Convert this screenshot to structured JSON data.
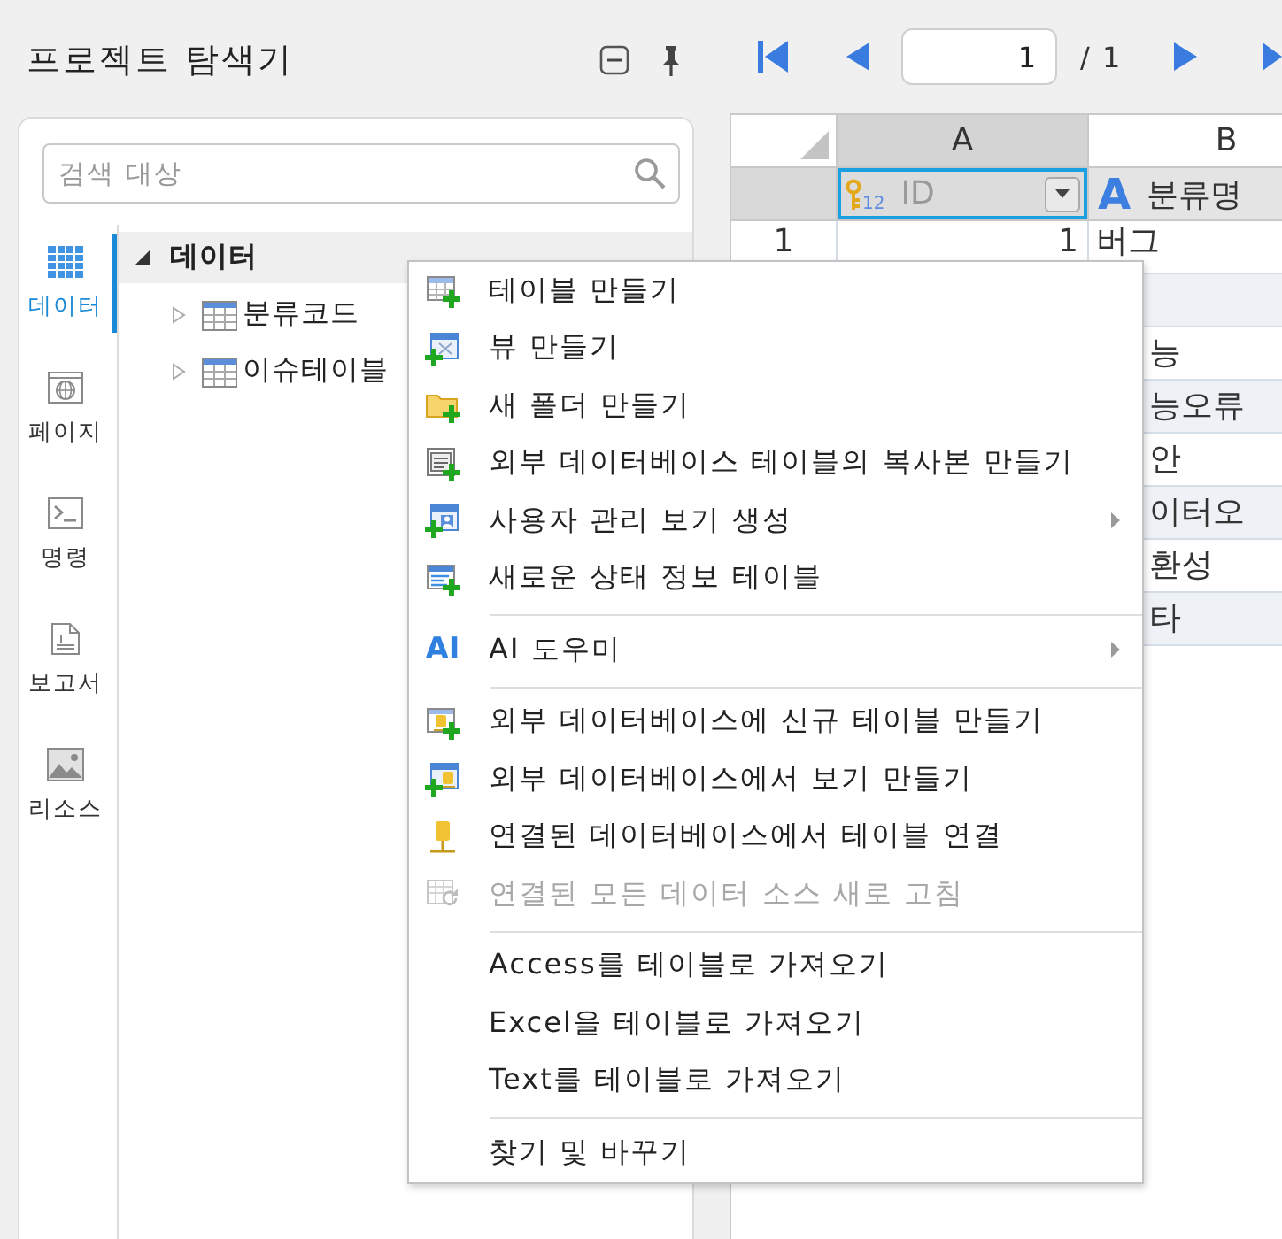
{
  "explorer": {
    "title": "프로젝트 탐색기",
    "search": {
      "placeholder": "검색 대상"
    },
    "nav": [
      {
        "label": "데이터",
        "selected": true
      },
      {
        "label": "페이지",
        "selected": false
      },
      {
        "label": "명령",
        "selected": false
      },
      {
        "label": "보고서",
        "selected": false
      },
      {
        "label": "리소스",
        "selected": false
      }
    ],
    "tree": [
      {
        "label": "데이터",
        "expanded": true,
        "selected": true,
        "children": [
          {
            "label": "분류코드",
            "expanded": false,
            "selected": false
          },
          {
            "label": "이슈테이블",
            "expanded": false,
            "selected": false
          }
        ]
      }
    ]
  },
  "pager": {
    "page": "1",
    "total": "/ 1"
  },
  "grid": {
    "columns": [
      {
        "letter": "A",
        "field": "ID",
        "kind": "number",
        "type_badge": "12",
        "primary_key": true,
        "selected": true
      },
      {
        "letter": "B",
        "field": "분류명",
        "kind": "text",
        "type_badge": "A",
        "primary_key": false,
        "selected": false
      }
    ],
    "rows": [
      {
        "number": "1",
        "id": "1",
        "name": "버그"
      },
      {},
      {
        "name": "능"
      },
      {
        "name": "능오류"
      },
      {
        "name": "안"
      },
      {
        "name": "이터오"
      },
      {
        "name": "환성"
      },
      {
        "name": "타"
      }
    ]
  },
  "context_menu": {
    "groups": [
      {
        "items": [
          {
            "label": "테이블 만들기",
            "submenu": false,
            "disabled": false
          },
          {
            "label": "뷰 만들기",
            "submenu": false,
            "disabled": false
          },
          {
            "label": "새 폴더 만들기",
            "submenu": false,
            "disabled": false
          },
          {
            "label": "외부 데이터베이스 테이블의 복사본 만들기",
            "submenu": false,
            "disabled": false
          },
          {
            "label": "사용자 관리 보기 생성",
            "submenu": true,
            "disabled": false
          },
          {
            "label": "새로운 상태 정보 테이블",
            "submenu": false,
            "disabled": false
          }
        ]
      },
      {
        "items": [
          {
            "label": "AI 도우미",
            "icon_text": "AI",
            "submenu": true,
            "disabled": false
          }
        ]
      },
      {
        "items": [
          {
            "label": "외부 데이터베이스에 신규 테이블 만들기",
            "submenu": false,
            "disabled": false
          },
          {
            "label": "외부 데이터베이스에서 보기 만들기",
            "submenu": false,
            "disabled": false
          },
          {
            "label": "연결된 데이터베이스에서 테이블 연결",
            "submenu": false,
            "disabled": false
          },
          {
            "label": "연결된 모든 데이터 소스 새로 고침",
            "submenu": false,
            "disabled": true
          }
        ]
      },
      {
        "items": [
          {
            "label": "Access를 테이블로 가져오기",
            "submenu": false,
            "disabled": false
          },
          {
            "label": "Excel을 테이블로 가져오기",
            "submenu": false,
            "disabled": false
          },
          {
            "label": "Text를 테이블로 가져오기",
            "submenu": false,
            "disabled": false
          }
        ]
      },
      {
        "items": [
          {
            "label": "찾기 및 바꾸기",
            "submenu": false,
            "disabled": false
          }
        ]
      }
    ]
  }
}
